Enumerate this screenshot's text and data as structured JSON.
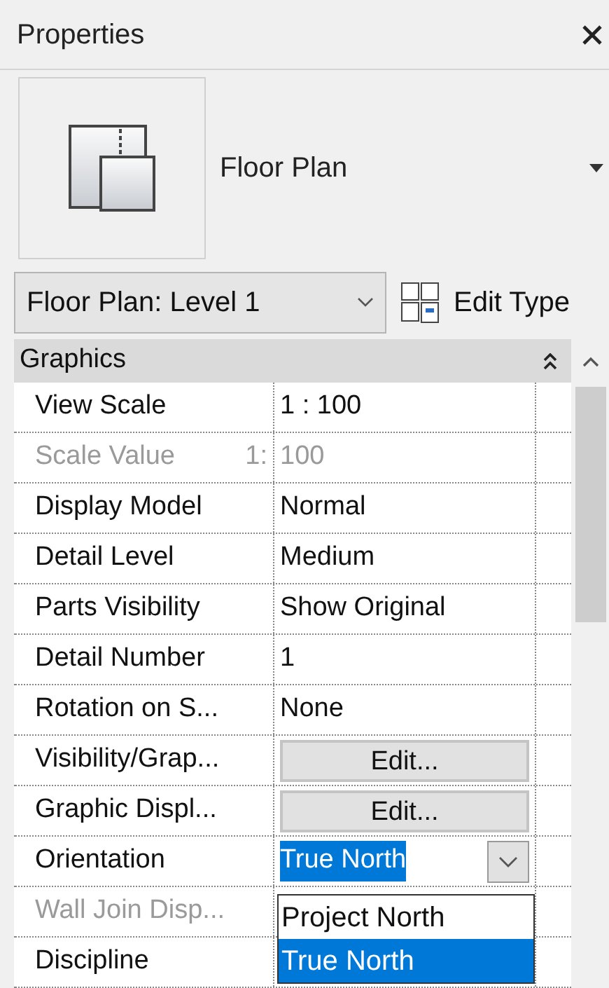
{
  "panel": {
    "title": "Properties"
  },
  "type_selector": {
    "type_name": "Floor Plan"
  },
  "instance_selector": {
    "value": "Floor Plan: Level 1",
    "edit_type_label": "Edit Type"
  },
  "group": {
    "label": "Graphics",
    "expanded": true
  },
  "rows": [
    {
      "label": "View Scale",
      "kind": "text",
      "value": "1 : 100",
      "disabled": false
    },
    {
      "label": "Scale Value",
      "suffix": "1:",
      "kind": "text",
      "value": "100",
      "disabled": true
    },
    {
      "label": "Display Model",
      "kind": "text",
      "value": "Normal",
      "disabled": false
    },
    {
      "label": "Detail Level",
      "kind": "text",
      "value": "Medium",
      "disabled": false
    },
    {
      "label": "Parts Visibility",
      "kind": "text",
      "value": "Show Original",
      "disabled": false
    },
    {
      "label": "Detail Number",
      "kind": "text",
      "value": "1",
      "disabled": false
    },
    {
      "label": "Rotation on S...",
      "kind": "text",
      "value": "None",
      "disabled": false
    },
    {
      "label": "Visibility/Grap...",
      "kind": "button",
      "value": "Edit...",
      "disabled": false
    },
    {
      "label": "Graphic Displ...",
      "kind": "button",
      "value": "Edit...",
      "disabled": false
    },
    {
      "label": "Orientation",
      "kind": "dropdown",
      "value": "True North",
      "disabled": false
    },
    {
      "label": "Wall Join Disp...",
      "disabled": true
    },
    {
      "label": "Discipline",
      "disabled": false
    }
  ],
  "dropdown_options": [
    {
      "label": "Project North",
      "selected": false
    },
    {
      "label": "True North",
      "selected": true
    }
  ]
}
